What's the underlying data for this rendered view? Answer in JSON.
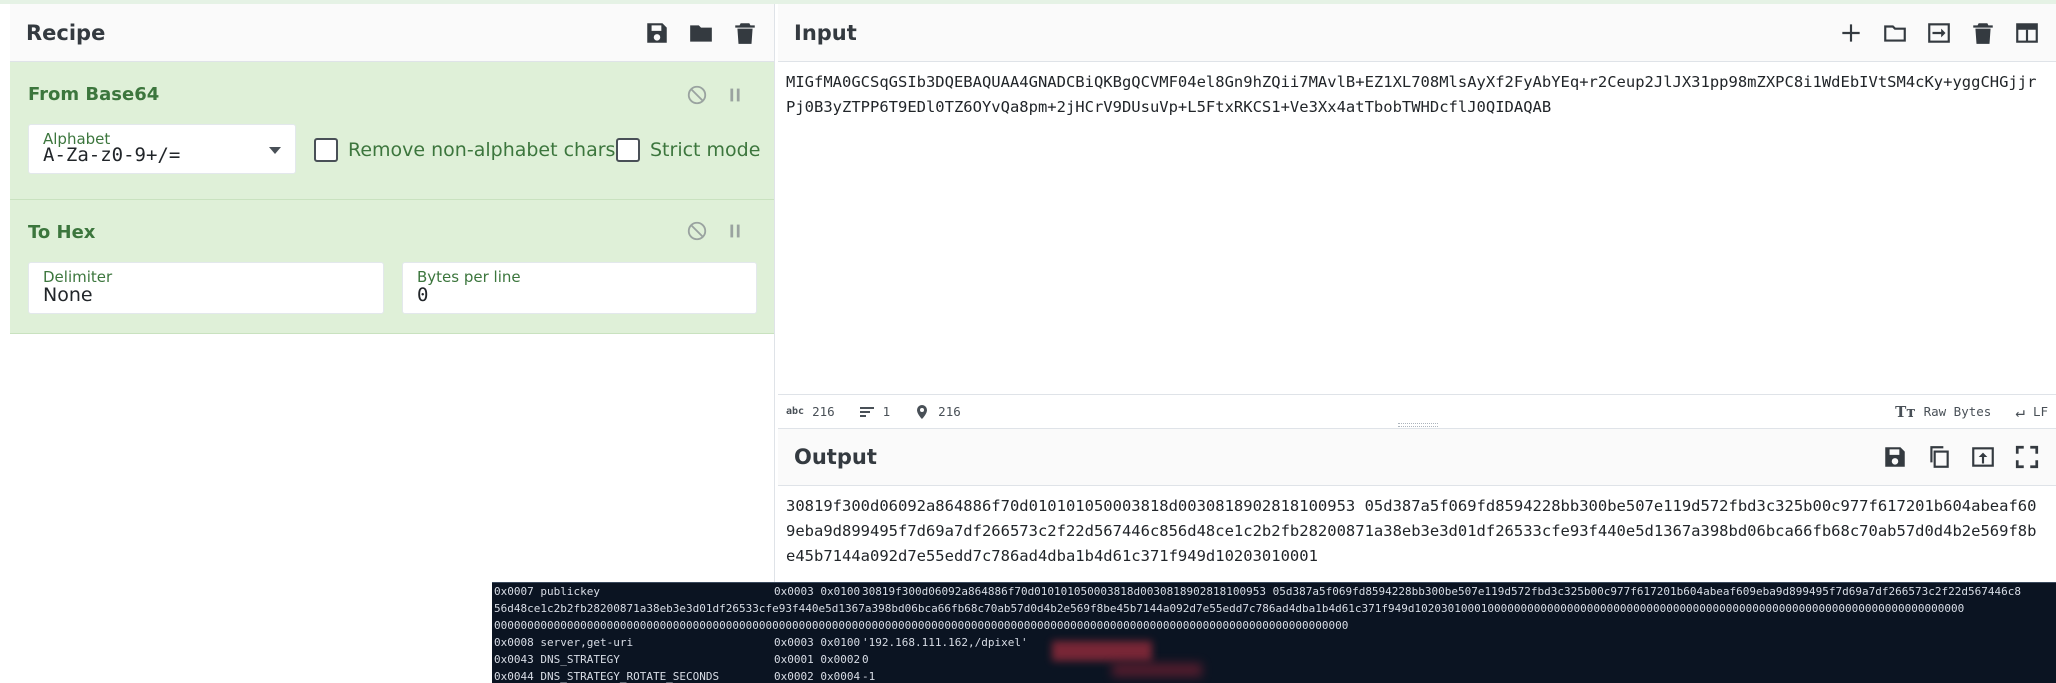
{
  "recipe": {
    "title": "Recipe",
    "operations": [
      {
        "title": "From Base64",
        "alphabet_label": "Alphabet",
        "alphabet_value": "A-Za-z0-9+/=",
        "remove_label": "Remove non-alphabet chars",
        "strict_label": "Strict mode"
      },
      {
        "title": "To Hex",
        "delimiter_label": "Delimiter",
        "delimiter_value": "None",
        "bpl_label": "Bytes per line",
        "bpl_value": "0"
      }
    ]
  },
  "input": {
    "title": "Input",
    "text": "MIGfMA0GCSqGSIb3DQEBAQUAA4GNADCBiQKBgQCVMF04el8Gn9hZQii7MAvlB+EZ1XL708MlsAyXf2FyAbYEq+r2Ceup2JlJX31pp98mZXPC8i1WdEbIVtSM4cKy+yggCHGjjrPj0B3yZTPP6T9EDl0TZ6OYvQa8pm+2jHCrV9DUsuVp+L5FtxRKCS1+Ve3Xx4atTbobTWHDcflJ0QIDAQAB"
  },
  "status": {
    "length": "216",
    "lines": "1",
    "position": "216",
    "encoding": "Raw Bytes",
    "eol": "LF"
  },
  "output": {
    "title": "Output",
    "text": "30819f300d06092a864886f70d010101050003818d0030818902818100953 05d387a5f069fd8594228bb300be507e119d572fbd3c325b00c977f617201b604abeaf609eba9d899495f7d69a7df266573c2f22d567446c856d48ce1c2b2fb28200871a38eb3e3d01df26533cfe93f440e5d1367a398bd06bca66fb68c70ab57d0d4b2e569f8be45b7144a092d7e55edd7c786ad4dba1b4d61c371f949d10203010001"
  },
  "terminal": {
    "lines": [
      {
        "key": "0x0007 publickey",
        "meta": "0x0003 0x0100",
        "value": "30819f300d06092a864886f70d010101050003818d0030818902818100953 05d387a5f069fd8594228bb300be507e119d572fbd3c325b00c977f617201b604abeaf609eba9d899495f7d69a7df266573c2f22d567446c8"
      },
      {
        "key": "",
        "meta": "",
        "value": "56d48ce1c2b2fb28200871a38eb3e3d01df26533cfe93f440e5d1367a398bd06bca66fb68c70ab57d0d4b2e569f8be45b7144a092d7e55edd7c786ad4dba1b4d61c371f949d10203010001000000000000000000000000000000000000000000000000000000000000000000000000"
      },
      {
        "key": "",
        "meta": "",
        "value": "000000000000000000000000000000000000000000000000000000000000000000000000000000000000000000000000000000000000000000000000000000000"
      },
      {
        "key": "0x0008 server,get-uri",
        "meta": "0x0003 0x0100",
        "value": "'192.168.111.162,/dpixel'"
      },
      {
        "key": "0x0043 DNS_STRATEGY",
        "meta": "0x0001 0x0002",
        "value": "0"
      },
      {
        "key": "0x0044 DNS_STRATEGY_ROTATE_SECONDS",
        "meta": "0x0002 0x0004",
        "value": "-1"
      }
    ]
  },
  "colors": {
    "op_background": "#dff0d8",
    "op_text": "#3c763d",
    "terminal_bg": "#0b1422"
  },
  "icons": {
    "recipe": [
      "save-icon",
      "folder-icon",
      "trash-icon"
    ],
    "input": [
      "plus-icon",
      "folder-icon",
      "import-icon",
      "trash-icon",
      "layout-icon"
    ],
    "output": [
      "save-icon",
      "copy-icon",
      "export-icon",
      "fullscreen-icon"
    ],
    "op_controls": [
      "disable-icon",
      "pause-icon"
    ]
  }
}
